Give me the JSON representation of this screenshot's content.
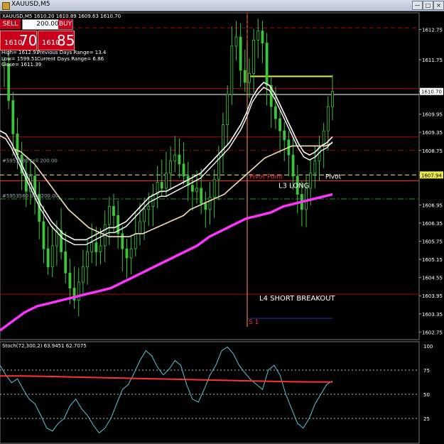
{
  "window": {
    "title": "XAUUSD,M5"
  },
  "trade": {
    "sell_label": "SELL",
    "buy_label": "BUY",
    "lots": "200.00",
    "bid_small": "1610",
    "bid_big": "70",
    "ask_small": "1610",
    "ask_big": "85"
  },
  "info": {
    "high": "High= 1612.91",
    "low": "Low= 1599.51",
    "close": "Close= 1611.39",
    "prev_range": "Previous Days Range= 13.4",
    "curr_range": "Current Days Range= 6.86"
  },
  "chart_data": [
    {
      "type": "candlestick",
      "title": "XAUUSD,M5",
      "header": "XAUUSD,M5  1610.20 1610.89 1609.63 1610.70",
      "ohlc_readout": [
        "1610.20",
        "1610.89",
        "1609.63",
        "1610.70"
      ],
      "ylim": [
        1602.5,
        1613.3
      ],
      "y_ticks": [
        "1612.75",
        "1611.75",
        "1610.70",
        "1609.95",
        "1609.35",
        "1608.75",
        "1607.94",
        "1606.95",
        "1606.35",
        "1605.75",
        "1605.15",
        "1604.55",
        "1603.95",
        "1603.35",
        "1602.75"
      ],
      "close_series": [
        1611.6,
        1610.4,
        1609.3,
        1608.6,
        1608.0,
        1607.4,
        1607.9,
        1607.3,
        1606.4,
        1605.5,
        1604.9,
        1605.6,
        1606.1,
        1605.4,
        1604.7,
        1604.2,
        1603.8,
        1604.4,
        1604.9,
        1605.4,
        1605.7,
        1605.4,
        1605.6,
        1606.3,
        1606.9,
        1606.6,
        1606.0,
        1605.5,
        1605.2,
        1605.5,
        1606.0,
        1606.4,
        1606.8,
        1606.9,
        1607.3,
        1607.7,
        1607.5,
        1608.0,
        1608.4,
        1608.6,
        1608.3,
        1607.9,
        1607.6,
        1607.4,
        1607.5,
        1607.0,
        1606.8,
        1607.2,
        1607.8,
        1608.6,
        1609.6,
        1610.6,
        1612.2,
        1612.5,
        1611.4,
        1611.0,
        1611.3,
        1612.4,
        1612.7,
        1612.3,
        1610.9,
        1610.2,
        1609.8,
        1609.4,
        1609.1,
        1608.6,
        1607.9,
        1607.3,
        1606.8,
        1607.5,
        1608.0,
        1608.4,
        1608.9,
        1609.4,
        1610.2,
        1610.7
      ],
      "ma_series": [
        {
          "name": "",
          "color": "#ffffff",
          "values": [
            1609.4,
            1609.3,
            1609.0,
            1608.6,
            1608.2,
            1607.8,
            1607.4,
            1607.0,
            1606.7,
            1606.4,
            1606.2,
            1606.0,
            1605.9,
            1605.8,
            1605.8,
            1605.8,
            1605.9,
            1606.0,
            1606.1,
            1606.2,
            1606.2,
            1606.3,
            1606.4,
            1606.6,
            1606.8,
            1607.0,
            1607.2,
            1607.3,
            1607.4,
            1607.4,
            1607.5,
            1607.6,
            1607.7,
            1607.8,
            1607.9,
            1608.0,
            1608.2,
            1608.4,
            1608.6,
            1608.8,
            1609.0,
            1609.3,
            1609.6,
            1610.0,
            1610.5,
            1610.8,
            1611.0,
            1610.9,
            1610.6,
            1610.2,
            1609.8,
            1609.4,
            1609.0,
            1608.7,
            1608.6,
            1608.7,
            1608.9,
            1609.0,
            1609.2
          ]
        },
        {
          "name": "",
          "color": "#f5deb3",
          "values": [
            1608.8,
            1608.7,
            1608.5,
            1608.3,
            1608.0,
            1607.7,
            1607.4,
            1607.1,
            1606.8,
            1606.6,
            1606.4,
            1606.2,
            1606.1,
            1606.0,
            1605.9,
            1605.9,
            1605.9,
            1605.9,
            1606.0,
            1606.0,
            1606.1,
            1606.2,
            1606.3,
            1606.4,
            1606.5,
            1606.6,
            1606.8,
            1606.9,
            1607.0,
            1607.1,
            1607.2,
            1607.3,
            1607.5,
            1607.7,
            1607.9,
            1608.1,
            1608.3,
            1608.5,
            1608.6,
            1608.7,
            1608.8,
            1608.9,
            1608.9,
            1608.9,
            1608.9,
            1608.9,
            1608.9,
            1609.0
          ]
        },
        {
          "name": "",
          "color": "#ff33ff",
          "values": [
            1602.8,
            1603.1,
            1603.4,
            1603.6,
            1603.7,
            1603.8,
            1603.9,
            1604.0,
            1604.1,
            1604.2,
            1604.4,
            1604.6,
            1604.8,
            1605.0,
            1605.2,
            1605.4,
            1605.6,
            1605.9,
            1606.1,
            1606.3,
            1606.5,
            1606.6,
            1606.7,
            1606.9,
            1607.0,
            1607.1,
            1607.2,
            1607.3
          ]
        }
      ],
      "levels": [
        {
          "label": "",
          "value": 1612.8,
          "color": "#b00000",
          "style": "dash"
        },
        {
          "label": "",
          "value": 1611.2,
          "color": "#e8e84a",
          "style": "solid"
        },
        {
          "label": "",
          "value": 1610.8,
          "color": "#b00000",
          "style": "solid"
        },
        {
          "label": "",
          "value": 1610.6,
          "color": "#ffffff",
          "style": "solid"
        },
        {
          "label": "",
          "value": 1609.2,
          "color": "#b00000",
          "style": "solid"
        },
        {
          "label": "",
          "value": 1608.75,
          "color": "#b00000",
          "style": "dashdot"
        },
        {
          "label": "",
          "value": 1607.94,
          "color": "#e8e8a0",
          "style": "dash"
        },
        {
          "label": "Pivot Point",
          "value": 1607.75,
          "color": "#ff3333",
          "style": "solid"
        },
        {
          "label": "",
          "value": 1607.15,
          "color": "#2e8b2e",
          "style": "dashdot"
        },
        {
          "label": "L4 SHORT BREAKOUT",
          "value": 1604.0,
          "color": "#b00000",
          "style": "solid"
        },
        {
          "label": "S 1",
          "value": 1603.2,
          "color": "#2030c0",
          "style": "solid"
        }
      ],
      "annotations": [
        "Pivot Point",
        "Pivot",
        "L3 LONG",
        "L4 SHORT BREAKOUT",
        "S 1",
        "#5953580 sell 200.00",
        "#5953580 buy 200.00"
      ],
      "price_labels": [
        "1610.70",
        "1607.94"
      ]
    },
    {
      "type": "line",
      "title": "Stoch(72,300,2) 63.9451 62.7075",
      "ylim": [
        0,
        100
      ],
      "y_ticks": [
        "100",
        "75",
        "50",
        "25"
      ],
      "series": [
        {
          "name": "",
          "color": "#55c8d8",
          "values": [
            80,
            70,
            62,
            66,
            55,
            45,
            40,
            28,
            15,
            12,
            20,
            25,
            38,
            45,
            35,
            28,
            18,
            10,
            15,
            25,
            40,
            55,
            60,
            72,
            85,
            95,
            90,
            78,
            70,
            76,
            85,
            80,
            60,
            45,
            42,
            55,
            70,
            80,
            95,
            99,
            92,
            80,
            72,
            65,
            60,
            55,
            75,
            80,
            70,
            50,
            35,
            20,
            15,
            25,
            40,
            50,
            60,
            64
          ]
        },
        {
          "name": "",
          "color": "#ff3333",
          "values": [
            69,
            69,
            68.5,
            68,
            67.5,
            67,
            66.5,
            66,
            65.5,
            65,
            64.5,
            64,
            63.5,
            63,
            62.8,
            62.7
          ]
        }
      ]
    }
  ]
}
